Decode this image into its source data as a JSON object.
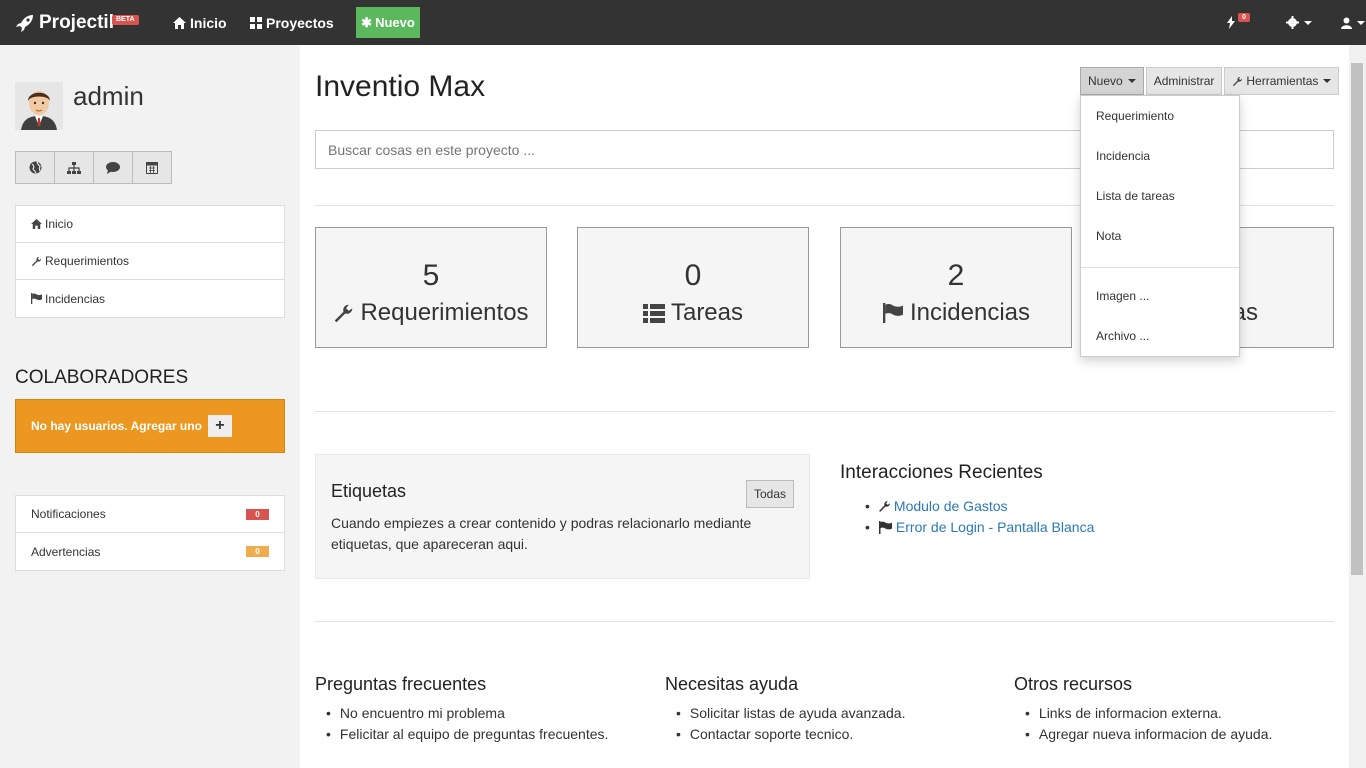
{
  "navbar": {
    "brand": "Projectil",
    "beta": "BETA",
    "home": "Inicio",
    "projects": "Proyectos",
    "new": "Nuevo",
    "notif_count": "0"
  },
  "sidebar": {
    "username": "admin",
    "nav": [
      "Inicio",
      "Requerimientos",
      "Incidencias"
    ],
    "collab_title": "COLABORADORES",
    "collab_empty": "No hay usuarios. Agregar uno",
    "notifications_label": "Notificaciones",
    "notifications_count": "0",
    "warnings_label": "Advertencias",
    "warnings_count": "0"
  },
  "main": {
    "title": "Inventio Max",
    "buttons": {
      "new": "Nuevo",
      "admin": "Administrar",
      "tools": "Herramientas"
    },
    "search_placeholder": "Buscar cosas en este proyecto ...",
    "stats": [
      {
        "value": "5",
        "label": "Requerimientos"
      },
      {
        "value": "0",
        "label": "Tareas"
      },
      {
        "value": "2",
        "label": "Incidencias"
      },
      {
        "value": "",
        "label": "as"
      }
    ],
    "dropdown": [
      "Requerimiento",
      "Incidencia",
      "Lista de tareas",
      "Nota",
      "Imagen ...",
      "Archivo ..."
    ],
    "tags": {
      "title": "Etiquetas",
      "button": "Todas",
      "text": "Cuando empiezes a crear contenido y podras relacionarlo mediante etiquetas, que apareceran aqui."
    },
    "recent": {
      "title": "Interacciones Recientes",
      "items": [
        "Modulo de Gastos",
        "Error de Login - Pantalla Blanca"
      ]
    },
    "footer": [
      {
        "title": "Preguntas frecuentes",
        "items": [
          "No encuentro mi problema",
          "Felicitar al equipo de preguntas frecuentes."
        ]
      },
      {
        "title": "Necesitas ayuda",
        "items": [
          "Solicitar listas de ayuda avanzada.",
          "Contactar soporte tecnico."
        ]
      },
      {
        "title": "Otros recursos",
        "items": [
          "Links de informacion externa.",
          "Agregar nueva informacion de ayuda."
        ]
      }
    ]
  },
  "colors": {
    "navbar": "#333333",
    "new_button": "#5cb85c",
    "collab_warning": "#ec971f",
    "badge_red": "#d9534f",
    "badge_orange": "#f0ad4e",
    "link": "#2a7ab8"
  }
}
